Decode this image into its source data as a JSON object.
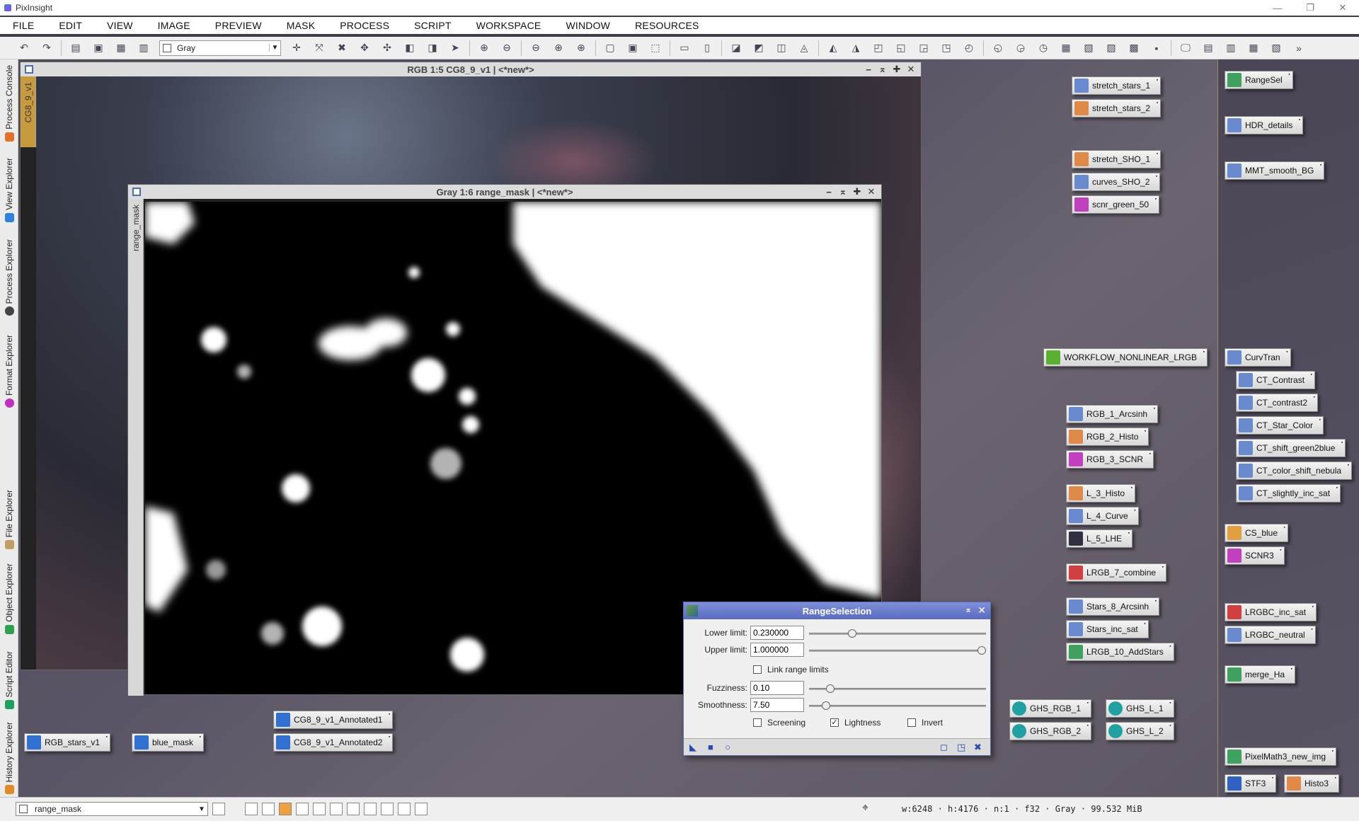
{
  "app": {
    "title": "PixInsight"
  },
  "menu": [
    "FILE",
    "EDIT",
    "VIEW",
    "IMAGE",
    "PREVIEW",
    "MASK",
    "PROCESS",
    "SCRIPT",
    "WORKSPACE",
    "WINDOW",
    "RESOURCES"
  ],
  "toolbar": {
    "view_combo": "Gray"
  },
  "left_dock": [
    "Process Console",
    "View Explorer",
    "Process Explorer",
    "Format Explorer",
    "File Explorer",
    "Object Explorer",
    "Script Editor",
    "History Explorer"
  ],
  "windows": {
    "rgb": {
      "title": "RGB 1:5 CG8_9_v1 | <*new*>",
      "tab": "CG8_9_v1"
    },
    "gray": {
      "title": "Gray 1:6 range_mask | <*new*>",
      "tab": "range_mask"
    }
  },
  "range_selection": {
    "title": "RangeSelection",
    "lower_label": "Lower limit:",
    "lower_value": "0.230000",
    "lower": 0.23,
    "upper_label": "Upper limit:",
    "upper_value": "1.000000",
    "upper": 1.0,
    "link_label": "Link range limits",
    "link_checked": false,
    "fuzz_label": "Fuzziness:",
    "fuzz_value": "0.10",
    "fuzz": 0.1,
    "smooth_label": "Smoothness:",
    "smooth_value": "7.50",
    "smooth": 0.075,
    "screening_label": "Screening",
    "screening_checked": false,
    "lightness_label": "Lightness",
    "lightness_checked": true,
    "invert_label": "Invert",
    "invert_checked": false
  },
  "workspace_icons": [
    {
      "label": "stretch_stars_1",
      "color": "#6a8ad0"
    },
    {
      "label": "stretch_stars_2",
      "color": "#e08a4a"
    },
    {
      "label": "stretch_SHO_1",
      "color": "#e08a4a"
    },
    {
      "label": "curves_SHO_2",
      "color": "#6a8ad0"
    },
    {
      "label": "scnr_green_50",
      "color": "#c040c0"
    },
    {
      "label": "WORKFLOW_NONLINEAR_LRGB",
      "color": "#5ab030"
    },
    {
      "label": "RGB_1_Arcsinh",
      "color": "#6a8ad0"
    },
    {
      "label": "RGB_2_Histo",
      "color": "#e08a4a"
    },
    {
      "label": "RGB_3_SCNR",
      "color": "#c040c0"
    },
    {
      "label": "L_3_Histo",
      "color": "#e08a4a"
    },
    {
      "label": "L_4_Curve",
      "color": "#6a8ad0"
    },
    {
      "label": "L_5_LHE",
      "color": "#303040"
    },
    {
      "label": "LRGB_7_combine",
      "color": "#d04040"
    },
    {
      "label": "Stars_8_Arcsinh",
      "color": "#6a8ad0"
    },
    {
      "label": "Stars_inc_sat",
      "color": "#6a8ad0"
    },
    {
      "label": "LRGB_10_AddStars",
      "color": "#40a060"
    },
    {
      "label": "GHS_RGB_1",
      "color": "#20a0a0"
    },
    {
      "label": "GHS_RGB_2",
      "color": "#20a0a0"
    },
    {
      "label": "GHS_L_1",
      "color": "#20a0a0"
    },
    {
      "label": "GHS_L_2",
      "color": "#20a0a0"
    },
    {
      "label": "RGB_stars_v1",
      "color": "#3070d0"
    },
    {
      "label": "blue_mask",
      "color": "#3070d0"
    },
    {
      "label": "CG8_9_v1_Annotated1",
      "color": "#3070d0"
    },
    {
      "label": "CG8_9_v1_Annotated2",
      "color": "#3070d0"
    }
  ],
  "right_icons": [
    {
      "label": "RangeSel",
      "color": "#40a060"
    },
    {
      "label": "HDR_details",
      "color": "#6a8ad0"
    },
    {
      "label": "MMT_smooth_BG",
      "color": "#6a8ad0"
    },
    {
      "label": "CurvTran",
      "color": "#6a8ad0"
    },
    {
      "label": "CT_Contrast",
      "color": "#6a8ad0"
    },
    {
      "label": "CT_contrast2",
      "color": "#6a8ad0"
    },
    {
      "label": "CT_Star_Color",
      "color": "#6a8ad0"
    },
    {
      "label": "CT_shift_green2blue",
      "color": "#6a8ad0"
    },
    {
      "label": "CT_color_shift_nebula",
      "color": "#6a8ad0"
    },
    {
      "label": "CT_slightly_inc_sat",
      "color": "#6a8ad0"
    },
    {
      "label": "CS_blue",
      "color": "#e0a040"
    },
    {
      "label": "SCNR3",
      "color": "#c040c0"
    },
    {
      "label": "LRGBC_inc_sat",
      "color": "#d04040"
    },
    {
      "label": "LRGBC_neutral",
      "color": "#6a8ad0"
    },
    {
      "label": "merge_Ha",
      "color": "#40a060"
    },
    {
      "label": "PixelMath3_new_img",
      "color": "#40a060"
    },
    {
      "label": "STF3",
      "color": "#3060c0"
    },
    {
      "label": "Histo3",
      "color": "#e08a4a"
    }
  ],
  "statusbar": {
    "view_combo": "range_mask",
    "info": "w:6248 · h:4176 · n:1 · f32 · Gray · 99.532 MiB"
  }
}
